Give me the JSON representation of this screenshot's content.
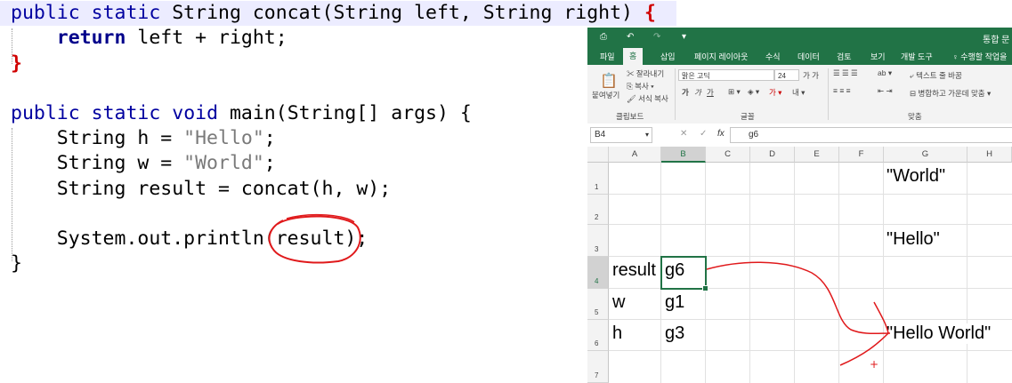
{
  "code": {
    "line1": {
      "kw1": "public",
      "kw2": "static",
      "text": " String concat(String left, String right) ",
      "brace": "{"
    },
    "line2": {
      "kw": "return",
      "rest": " left + right;"
    },
    "line3": "}",
    "line5": {
      "kw1": "public",
      "kw2": "static",
      "kw3": "void",
      "rest": " main(String[] args) {"
    },
    "line6": {
      "pre": "String h = ",
      "str": "\"Hello\"",
      "post": ";"
    },
    "line7": {
      "pre": "String w = ",
      "str": "\"World\"",
      "post": ";"
    },
    "line8": "String result = concat(h, w);",
    "line10": "System.out.println(result);",
    "line11": "}"
  },
  "excel": {
    "title_right": "통합 문",
    "quick_access": [
      "⎙",
      "↶",
      "↷",
      "▾"
    ],
    "tabs": [
      "파일",
      "홈",
      "삽입",
      "페이지 레이아웃",
      "수식",
      "데이터",
      "검토",
      "보기",
      "개발 도구"
    ],
    "tell_me": "♀ 수행할 작업을",
    "clipboard": {
      "paste": "붙여넣기",
      "cut": "잘라내기",
      "copy": "복사",
      "format_painter": "서식 복사",
      "group": "클립보드"
    },
    "font": {
      "name": "맑은 고딕",
      "size": "24",
      "group": "글꼴"
    },
    "alignment": {
      "wrap_text": "텍스트 줄 바꿈",
      "merge": "병합하고 가운데 맞춤",
      "group": "맞춤"
    },
    "name_box": "B4",
    "formula_value": "g6",
    "fx": "fx",
    "columns": [
      "A",
      "B",
      "C",
      "D",
      "E",
      "F",
      "G",
      "H"
    ],
    "rows": [
      "1",
      "2",
      "3",
      "4",
      "5",
      "6",
      "7"
    ],
    "cells": {
      "G1": "\"World\"",
      "G3": "\"Hello\"",
      "A4": "result",
      "B4": "g6",
      "A5": "w",
      "B5": "g1",
      "A6": "h",
      "B6": "g3",
      "G6": "\"Hello World\""
    }
  }
}
